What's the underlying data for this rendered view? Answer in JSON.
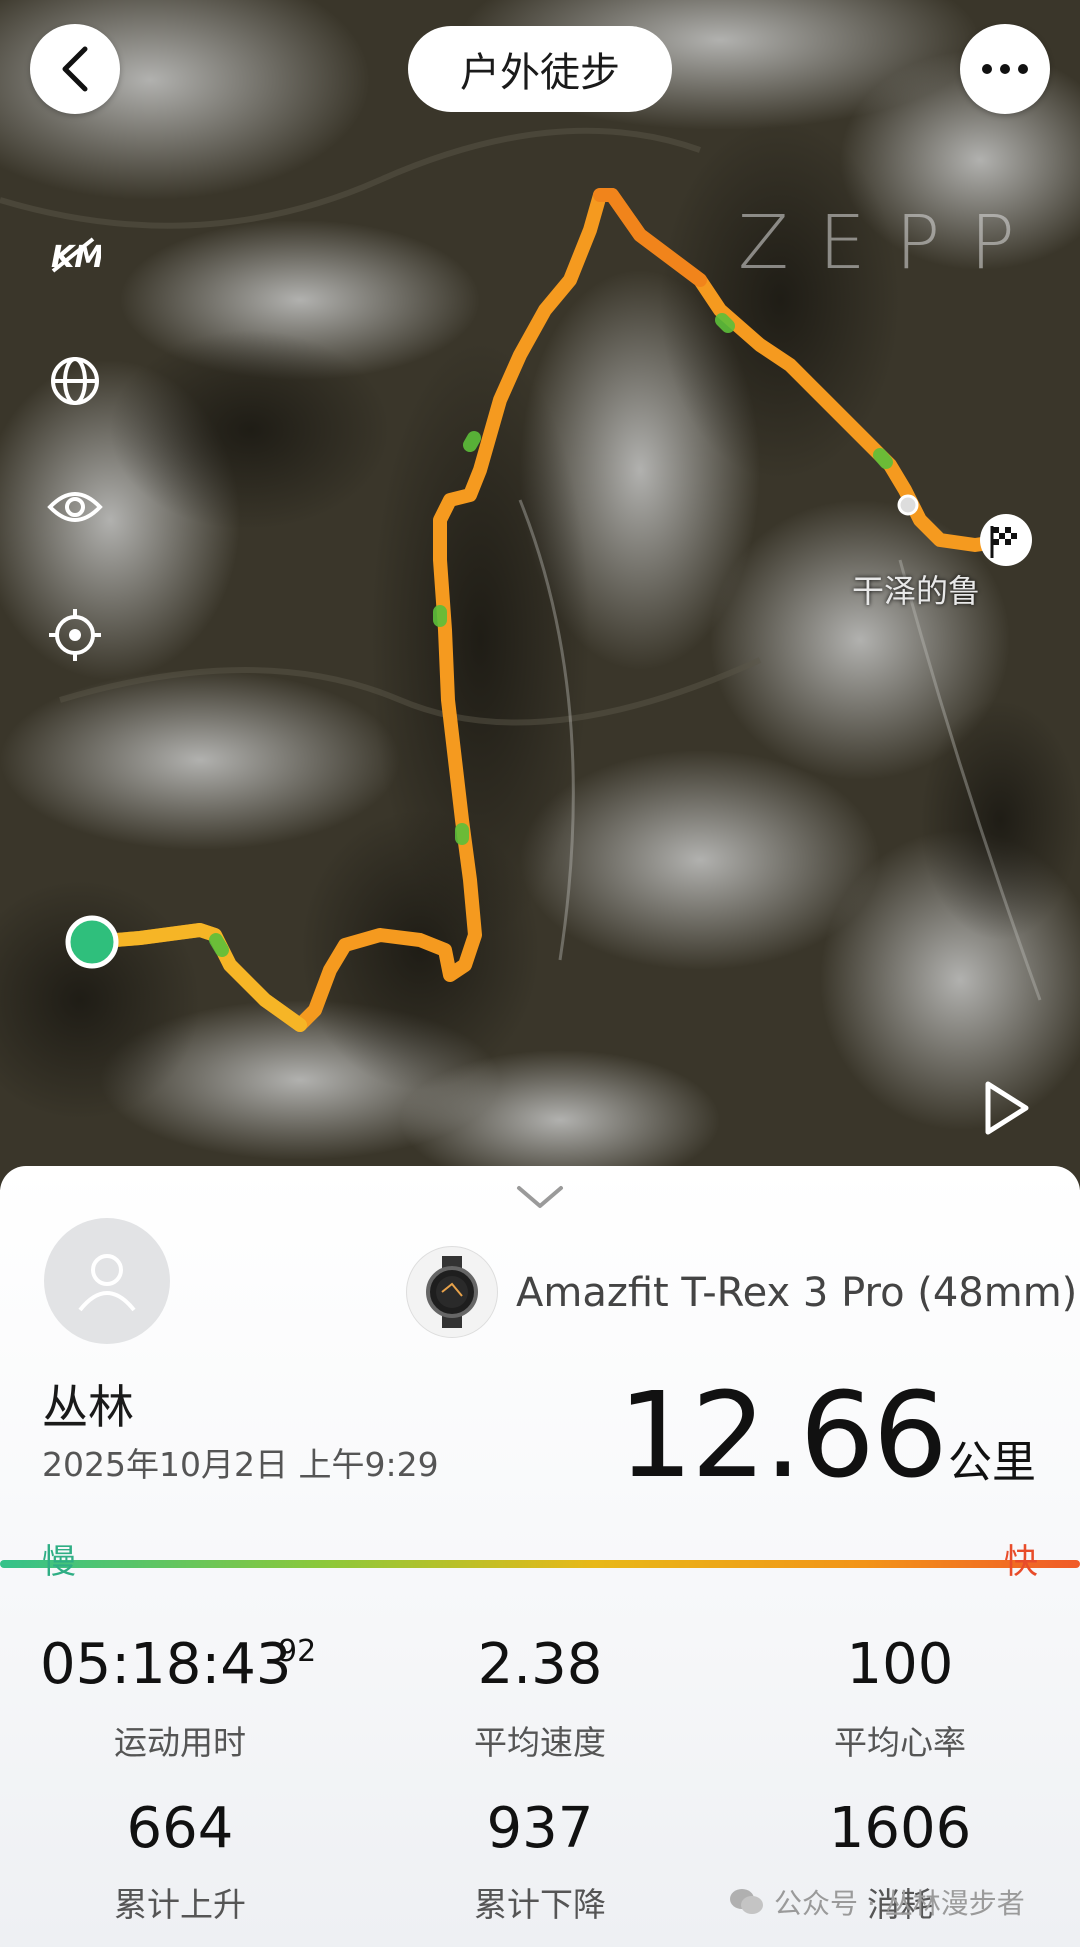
{
  "header": {
    "title": "户外徒步"
  },
  "map": {
    "logo": "ZEPP",
    "place_label": "干泽的鲁",
    "route_color": "#f59a1f",
    "start_color": "#2fbf7c"
  },
  "sheet": {
    "device_name": "Amazfit T-Rex 3 Pro (48mm)",
    "user_name": "丛林",
    "date_time": "2025年10月2日 上午9:29",
    "distance": "12.66",
    "distance_unit": "公里",
    "pace_slow": "慢",
    "pace_fast": "快",
    "stats": {
      "duration_main": "05:18:43",
      "duration_sub": "92",
      "duration_label": "运动用时",
      "avg_speed": "2.38",
      "avg_speed_label": "平均速度",
      "avg_hr": "100",
      "avg_hr_label": "平均心率",
      "ascent": "664",
      "ascent_label": "累计上升",
      "descent": "937",
      "descent_label": "累计下降",
      "calories": "1606",
      "calories_label": "消耗"
    }
  },
  "watermark": "公众号 · 丛林漫步者"
}
